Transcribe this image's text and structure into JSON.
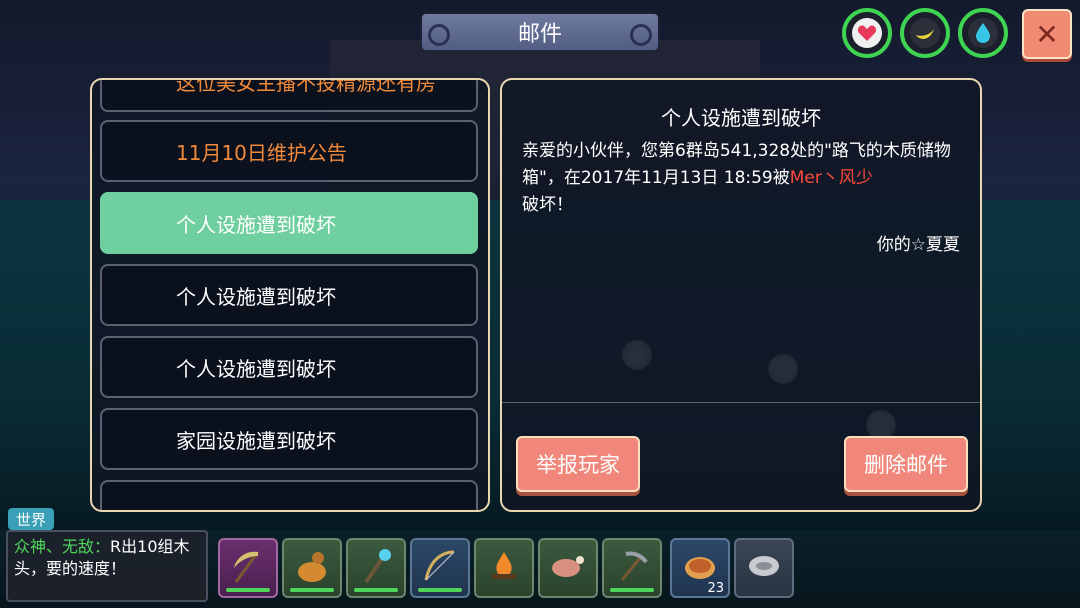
{
  "header": {
    "title": "邮件",
    "close_label": "✕"
  },
  "stats": {
    "health_icon": "heart-icon",
    "hunger_icon": "banana-icon",
    "thirst_icon": "water-drop-icon",
    "ring_color": "#3fd451"
  },
  "mail_list": {
    "items": [
      {
        "label": "这位美女主播不投精源还有房"
      },
      {
        "label": "11月10日维护公告"
      },
      {
        "label": "个人设施遭到破坏"
      },
      {
        "label": "个人设施遭到破坏"
      },
      {
        "label": "个人设施遭到破坏"
      },
      {
        "label": "家园设施遭到破坏"
      }
    ],
    "selected_index": 2
  },
  "mail_detail": {
    "title": "个人设施遭到破坏",
    "body_part1": "亲爱的小伙伴，您第6群岛541,328处的\"路飞的木质储物箱\"，在2017年11月13日 18:59被",
    "attacker": "Mer丶风少",
    "body_part2": "破坏！",
    "signature": "你的☆夏夏",
    "report_button": "举报玩家",
    "delete_button": "删除邮件"
  },
  "chat": {
    "tab_label": "世界",
    "sender": "众神、无敌：",
    "message": "R出10组木头，要的速度！"
  },
  "hotbar": {
    "slots": [
      {
        "icon": "scythe-icon"
      },
      {
        "icon": "gourd-icon"
      },
      {
        "icon": "staff-icon"
      },
      {
        "icon": "bow-icon"
      },
      {
        "icon": "campfire-icon"
      },
      {
        "icon": "meat-icon"
      },
      {
        "icon": "pickaxe-icon"
      },
      {
        "icon": "pie-icon",
        "count": "23"
      },
      {
        "icon": "stone-icon"
      }
    ]
  },
  "colors": {
    "accent_green": "#6fcf9e",
    "button_salmon": "#f0877a",
    "orange_text": "#f08a3a",
    "red_text": "#ff4a3a"
  }
}
